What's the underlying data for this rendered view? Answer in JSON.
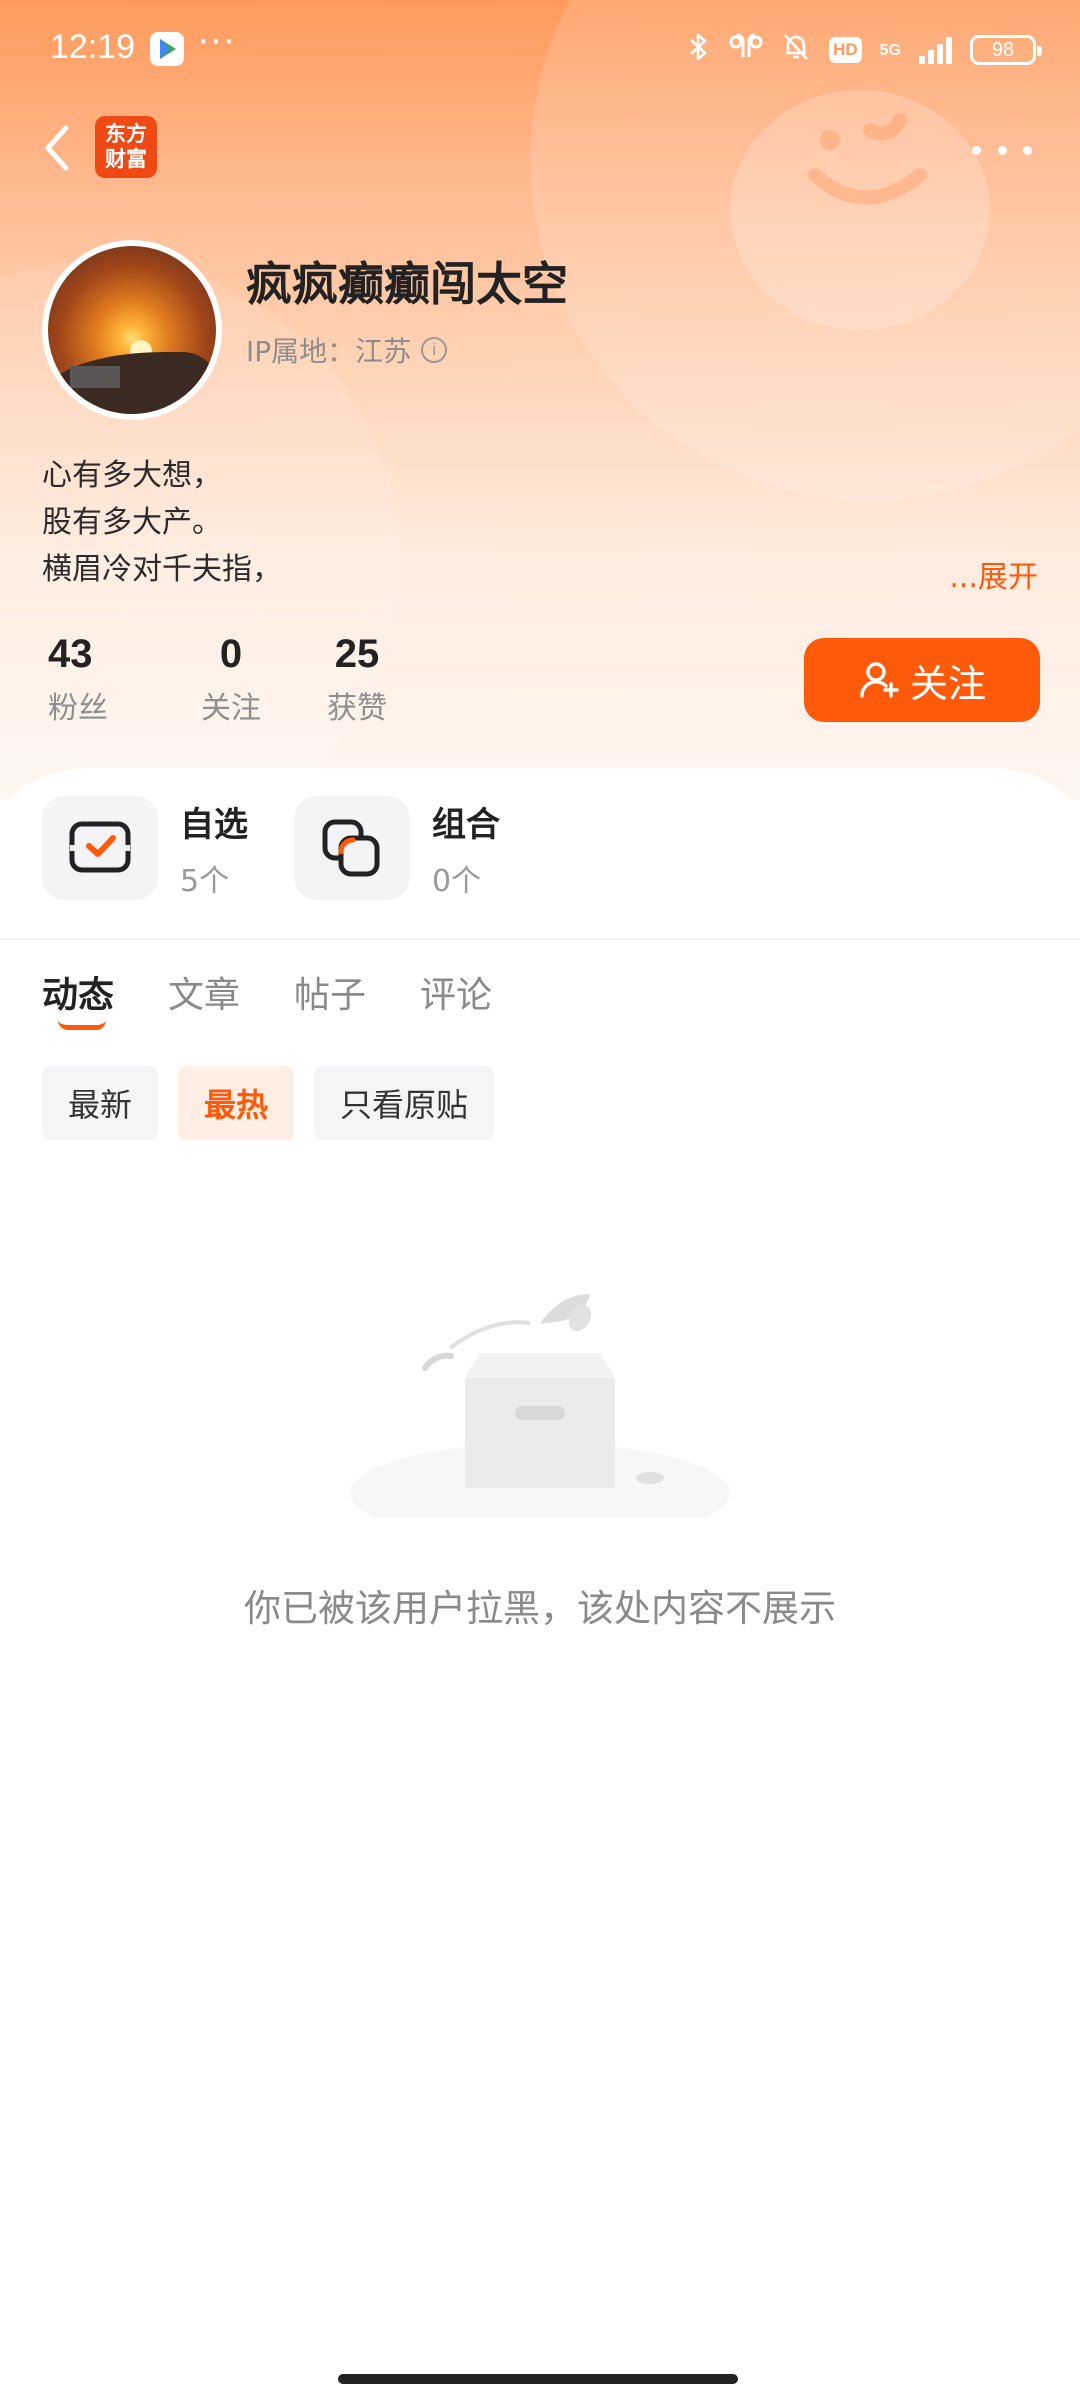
{
  "status_bar": {
    "time": "12:19",
    "dots": "···",
    "network": "5G",
    "hd": "HD",
    "battery": "98"
  },
  "nav": {
    "logo_text_line1": "东方",
    "logo_text_line2": "财富"
  },
  "profile": {
    "username": "疯疯癫癫闯太空",
    "ip_location": "IP属地：江苏",
    "bio_lines": [
      "心有多大想，",
      "股有多大产。",
      "横眉冷对千夫指，"
    ],
    "expand_label": "...展开",
    "stats": [
      {
        "value": "43",
        "label": "粉丝"
      },
      {
        "value": "0",
        "label": "关注"
      },
      {
        "value": "25",
        "label": "获赞"
      }
    ],
    "follow_label": "关注"
  },
  "shortcuts": [
    {
      "name": "自选",
      "count": "5个",
      "icon": "watchlist-check-icon"
    },
    {
      "name": "组合",
      "count": "0个",
      "icon": "portfolio-icon"
    }
  ],
  "tabs": [
    "动态",
    "文章",
    "帖子",
    "评论"
  ],
  "active_tab": "动态",
  "filters": [
    "最新",
    "最热",
    "只看原贴"
  ],
  "active_filter": "最热",
  "empty_message": "你已被该用户拉黑，该处内容不展示",
  "colors": {
    "accent": "#ff5a0a",
    "header_gradient_top": "#ff9a5c",
    "logo_bg": "#f04a14"
  }
}
